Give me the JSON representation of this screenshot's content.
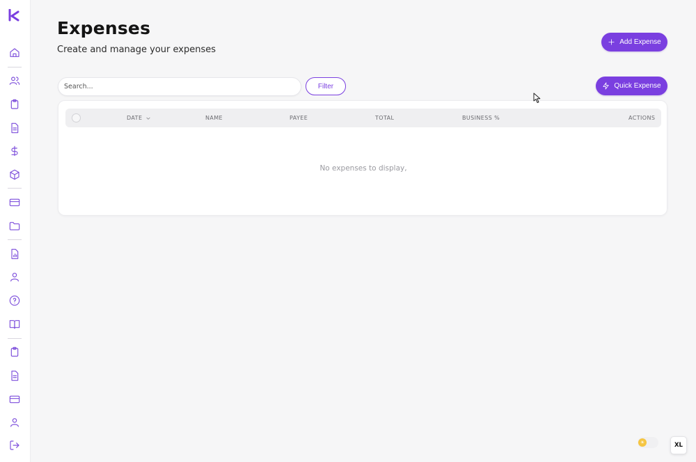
{
  "app": {
    "logo_letter": "k",
    "accent": "#7a3fe0"
  },
  "sidebar": {
    "items": [
      {
        "icon": "home-icon"
      },
      {
        "icon": "users-icon"
      },
      {
        "icon": "clipboard-icon"
      },
      {
        "icon": "document-icon"
      },
      {
        "icon": "dollar-icon"
      },
      {
        "icon": "box-icon"
      },
      {
        "icon": "credit-card-icon"
      },
      {
        "icon": "folder-icon"
      },
      {
        "icon": "report-icon"
      },
      {
        "icon": "user-icon"
      },
      {
        "icon": "help-icon"
      },
      {
        "icon": "book-icon"
      },
      {
        "icon": "clipboard-icon"
      },
      {
        "icon": "document-icon"
      },
      {
        "icon": "credit-card-icon"
      },
      {
        "icon": "user-icon"
      },
      {
        "icon": "logout-icon"
      }
    ]
  },
  "header": {
    "title": "Expenses",
    "subtitle": "Create and manage your expenses",
    "add_label": "Add Expense",
    "quick_label": "Quick Expense"
  },
  "toolbar": {
    "search_placeholder": "Search...",
    "filter_label": "Filter"
  },
  "table": {
    "columns": [
      "DATE",
      "NAME",
      "PAYEE",
      "TOTAL",
      "BUSINESS %",
      "ACTIONS"
    ],
    "sorted_column": "DATE",
    "empty_message": "No expenses to display,"
  },
  "footer": {
    "toggle_icon": "sun-icon",
    "size_label": "XL"
  }
}
